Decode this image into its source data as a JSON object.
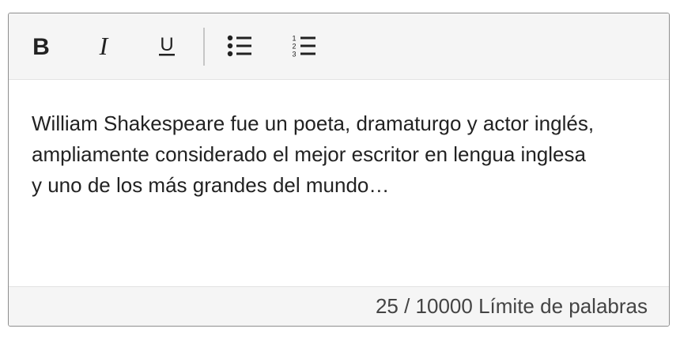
{
  "toolbar": {
    "bold": {
      "icon": "bold-icon",
      "label": "B"
    },
    "italic": {
      "icon": "italic-icon",
      "label": "I"
    },
    "underline": {
      "icon": "underline-icon",
      "label": "U"
    },
    "bulleted_list": {
      "icon": "bulleted-list-icon"
    },
    "numbered_list": {
      "icon": "numbered-list-icon"
    }
  },
  "content": {
    "lines": [
      "William Shakespeare fue un poeta, dramaturgo y actor inglés,",
      "ampliamente considerado el mejor escritor en lengua inglesa",
      "y uno de los más grandes del mundo…"
    ]
  },
  "footer": {
    "word_count": "25",
    "separator": " / ",
    "word_limit": "10000",
    "limit_label": "Límite de palabras"
  },
  "colors": {
    "toolbar_background": "#f5f5f5",
    "border": "#8e8e8e",
    "text": "#222222",
    "footer_text": "#444444"
  }
}
